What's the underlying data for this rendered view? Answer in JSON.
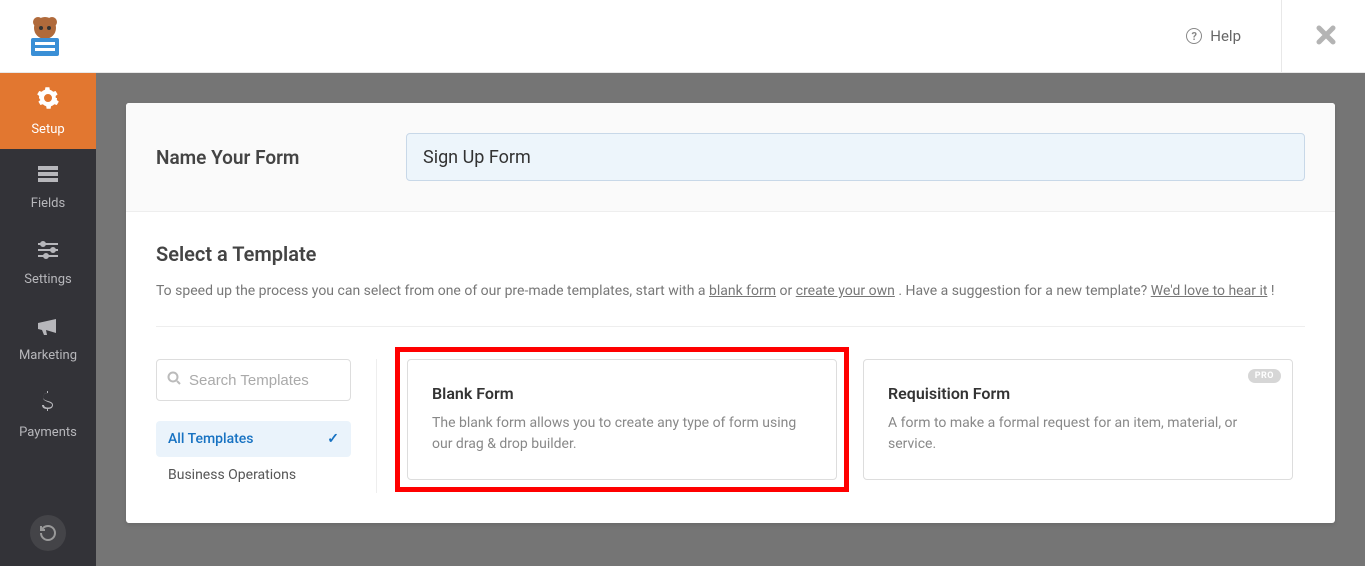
{
  "topbar": {
    "help_label": "Help"
  },
  "sidebar": {
    "items": [
      {
        "label": "Setup",
        "icon": "gear"
      },
      {
        "label": "Fields",
        "icon": "list"
      },
      {
        "label": "Settings",
        "icon": "sliders"
      },
      {
        "label": "Marketing",
        "icon": "megaphone"
      },
      {
        "label": "Payments",
        "icon": "dollar"
      }
    ]
  },
  "form_name": {
    "label": "Name Your Form",
    "value": "Sign Up Form"
  },
  "template_section": {
    "title": "Select a Template",
    "desc_pre": "To speed up the process you can select from one of our pre-made templates, start with a ",
    "link_blank": "blank form",
    "desc_mid1": " or ",
    "link_create": "create your own",
    "desc_mid2": ". Have a suggestion for a new template? ",
    "link_hear": "We'd love to hear it",
    "desc_end": "!"
  },
  "search": {
    "placeholder": "Search Templates"
  },
  "categories": [
    {
      "label": "All Templates",
      "active": true
    },
    {
      "label": "Business Operations",
      "active": false
    }
  ],
  "templates": [
    {
      "title": "Blank Form",
      "description": "The blank form allows you to create any type of form using our drag & drop builder."
    },
    {
      "title": "Requisition Form",
      "description": "A form to make a formal request for an item, material, or service.",
      "badge": "PRO"
    }
  ]
}
